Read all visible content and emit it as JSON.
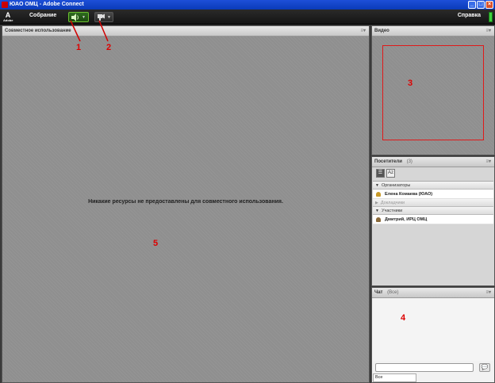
{
  "window": {
    "title": "ЮАО ОМЦ - Adobe Connect"
  },
  "menubar": {
    "logo_text": "A",
    "logo_sub": "Adobe",
    "meeting_label": "Собрание",
    "help_label": "Справка",
    "speaker_icon": "speaker-icon",
    "camera_icon": "webcam-icon"
  },
  "share_pod": {
    "title": "Совместное использование",
    "menu_glyph": "≡▾",
    "empty_message": "Никакие ресурсы не предоставлены для совместного использования."
  },
  "video_pod": {
    "title": "Видео",
    "menu_glyph": "≡▾"
  },
  "attendees_pod": {
    "title": "Посетители",
    "count": "(3)",
    "menu_glyph": "≡▾",
    "toolbar": [
      "☰",
      "Az"
    ],
    "groups": [
      {
        "label": "Организаторы",
        "members": [
          "Елена Комаева (ЮАО)"
        ]
      },
      {
        "label": "Докладчики",
        "members": []
      },
      {
        "label": "Участники",
        "members": [
          "Дмитрий, ИРЦ ОМЦ"
        ]
      }
    ]
  },
  "chat_pod": {
    "title": "Чат",
    "scope": "(Все)",
    "menu_glyph": "≡▾",
    "target": "Все",
    "input_value": ""
  },
  "annotations": [
    "1",
    "2",
    "3",
    "4",
    "5"
  ],
  "colors": {
    "annotation": "#d00000",
    "speaker_active": "#6bbf2f",
    "connection": "#3fd23f"
  }
}
